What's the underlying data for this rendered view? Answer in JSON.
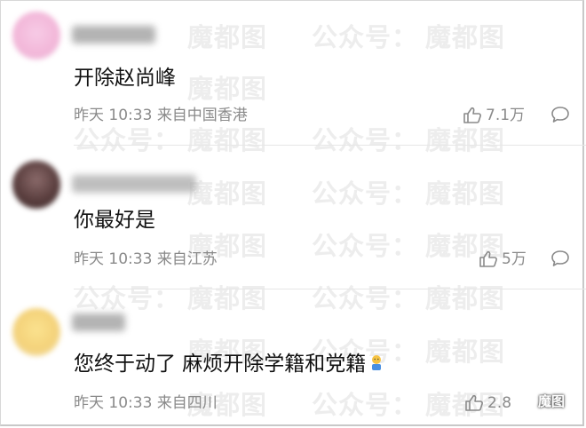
{
  "comments": [
    {
      "text": "开除赵尚峰",
      "time": "昨天 10:33",
      "location": "来自中国香港",
      "likes": "7.1万",
      "avatar_color": "#f2b6d8"
    },
    {
      "text": "你最好是",
      "time": "昨天 10:33",
      "location": "来自江苏",
      "likes": "5万",
      "avatar_color": "#6b4a4a"
    },
    {
      "text": "您终于动了 麻烦开除学籍和党籍",
      "time": "昨天 10:33",
      "location": "来自四川",
      "likes": "2.8",
      "avatar_color": "#f4d27a"
    }
  ],
  "icons": {
    "like": "thumbs-up-icon",
    "reply": "speech-bubble-icon",
    "emoji": "emoji-icon",
    "logo": "wechat-icon"
  },
  "watermark": {
    "label": "公众号：",
    "brand": "魔都图"
  },
  "logo": {
    "text": "魔图"
  }
}
